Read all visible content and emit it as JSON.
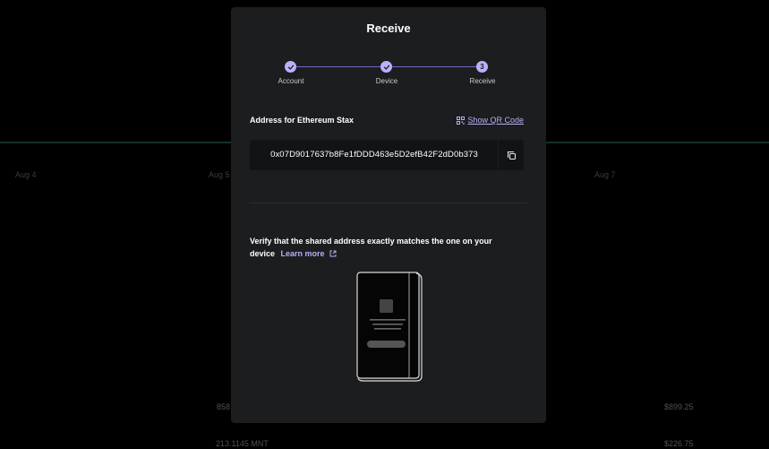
{
  "background": {
    "date_labels": [
      "Aug 4",
      "Aug 5",
      "Aug 7"
    ],
    "values": [
      "858",
      "$899.25",
      "213.1145 MNT",
      "$226.75"
    ]
  },
  "modal": {
    "title": "Receive",
    "steps": [
      {
        "label": "Account",
        "status": "done"
      },
      {
        "label": "Device",
        "status": "done"
      },
      {
        "label": "Receive",
        "status": "current",
        "number": "3"
      }
    ],
    "address_label": "Address for Ethereum Stax",
    "show_qr_label": "Show QR Code",
    "address": "0x07D9017637b8Fe1fDDD463e5D2efB42F2dD0b373",
    "verify_text": "Verify that the shared address exactly matches the one on your device",
    "learn_more_label": "Learn more"
  },
  "colors": {
    "accent": "#bbb0ff",
    "link": "#b7aef5",
    "modal_bg": "#1c1d1f",
    "address_bg": "#121314"
  },
  "icons": [
    "check-icon",
    "qr-code-icon",
    "copy-icon",
    "external-link-icon",
    "device-illustration"
  ]
}
